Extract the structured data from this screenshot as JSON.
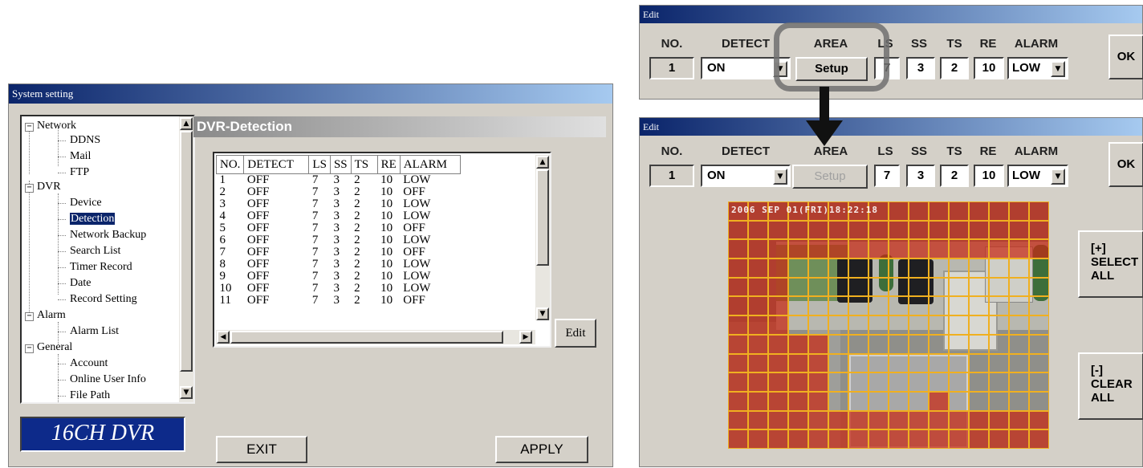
{
  "system_window": {
    "title": "System setting",
    "tree": {
      "network": "Network",
      "ddns": "DDNS",
      "mail": "Mail",
      "ftp": "FTP",
      "dvr": "DVR",
      "device": "Device",
      "detection": "Detection",
      "network_backup": "Network Backup",
      "search_list": "Search List",
      "timer_record": "Timer Record",
      "date": "Date",
      "record_setting": "Record Setting",
      "alarm": "Alarm",
      "alarm_list": "Alarm List",
      "general": "General",
      "account": "Account",
      "online_user_info": "Online User Info",
      "file_path": "File Path"
    },
    "logo": "16CH DVR",
    "section_title": "DVR-Detection",
    "table": {
      "headers": [
        "NO.",
        "DETECT",
        "LS",
        "SS",
        "TS",
        "RE",
        "ALARM"
      ],
      "rows": [
        [
          "1",
          "OFF",
          "7",
          "3",
          "2",
          "10",
          "LOW"
        ],
        [
          "2",
          "OFF",
          "7",
          "3",
          "2",
          "10",
          "OFF"
        ],
        [
          "3",
          "OFF",
          "7",
          "3",
          "2",
          "10",
          "LOW"
        ],
        [
          "4",
          "OFF",
          "7",
          "3",
          "2",
          "10",
          "LOW"
        ],
        [
          "5",
          "OFF",
          "7",
          "3",
          "2",
          "10",
          "OFF"
        ],
        [
          "6",
          "OFF",
          "7",
          "3",
          "2",
          "10",
          "LOW"
        ],
        [
          "7",
          "OFF",
          "7",
          "3",
          "2",
          "10",
          "OFF"
        ],
        [
          "8",
          "OFF",
          "7",
          "3",
          "2",
          "10",
          "LOW"
        ],
        [
          "9",
          "OFF",
          "7",
          "3",
          "2",
          "10",
          "LOW"
        ],
        [
          "10",
          "OFF",
          "7",
          "3",
          "2",
          "10",
          "LOW"
        ],
        [
          "11",
          "OFF",
          "7",
          "3",
          "2",
          "10",
          "OFF"
        ]
      ]
    },
    "edit_button": "Edit",
    "exit_button": "EXIT",
    "apply_button": "APPLY"
  },
  "edit_top": {
    "title": "Edit",
    "headers": {
      "no": "NO.",
      "detect": "DETECT",
      "area": "AREA",
      "ls": "LS",
      "ss": "SS",
      "ts": "TS",
      "re": "RE",
      "alarm": "ALARM"
    },
    "values": {
      "no": "1",
      "detect": "ON",
      "area_button": "Setup",
      "ls": "7",
      "ss": "3",
      "ts": "2",
      "re": "10",
      "alarm": "LOW"
    },
    "ok_button": "OK"
  },
  "edit_bottom": {
    "title": "Edit",
    "headers": {
      "no": "NO.",
      "detect": "DETECT",
      "area": "AREA",
      "ls": "LS",
      "ss": "SS",
      "ts": "TS",
      "re": "RE",
      "alarm": "ALARM"
    },
    "values": {
      "no": "1",
      "detect": "ON",
      "area_button": "Setup",
      "ls": "7",
      "ss": "3",
      "ts": "2",
      "re": "10",
      "alarm": "LOW"
    },
    "ok_button": "OK",
    "timestamp": "2006 SEP 01(FRI)18:22:18",
    "select_all": [
      "[+]",
      "SELECT",
      "ALL"
    ],
    "clear_all": [
      "[-]",
      "CLEAR",
      "ALL"
    ]
  },
  "colors": {
    "title_dark": "#0a246a",
    "title_light": "#a6caf0",
    "grid_red": "#c82814",
    "grid_line": "#f0b020"
  }
}
